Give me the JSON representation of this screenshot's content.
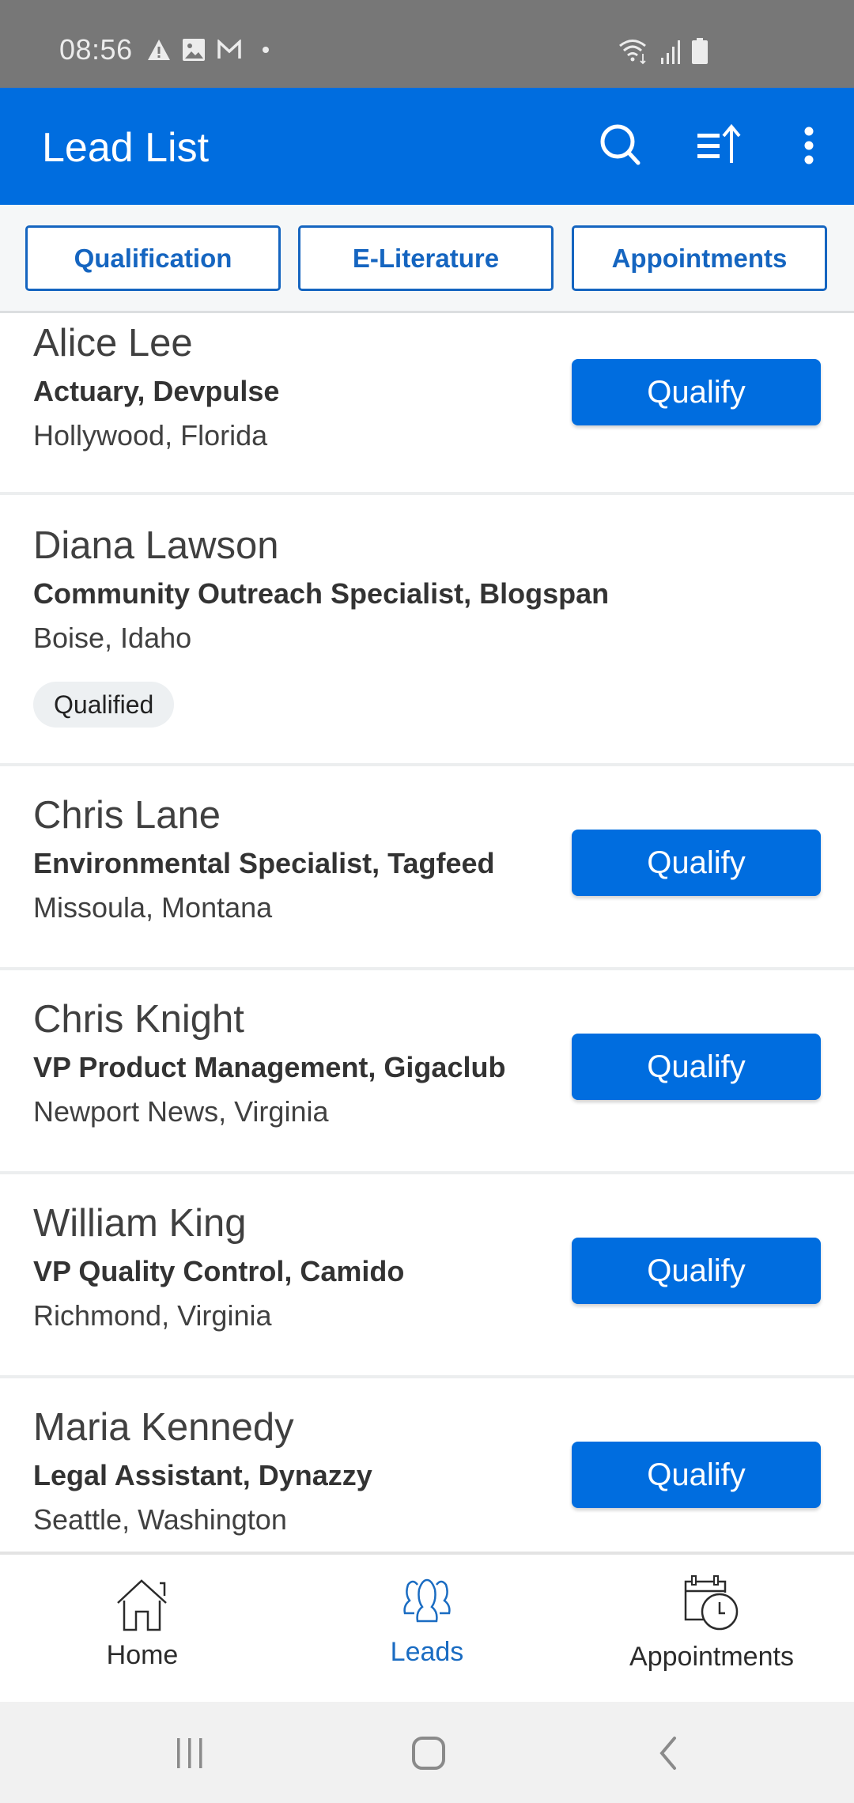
{
  "status_bar": {
    "time": "08:56",
    "left_icons": [
      "warning-icon",
      "image-icon",
      "gmail-icon",
      "dot-icon"
    ],
    "right_icons": [
      "wifi-icon",
      "signal-icon",
      "battery-icon"
    ]
  },
  "app_bar": {
    "title": "Lead List",
    "actions": [
      "search-icon",
      "sort-icon",
      "more-vert-icon"
    ]
  },
  "filters": [
    {
      "label": "Qualification"
    },
    {
      "label": "E-Literature"
    },
    {
      "label": "Appointments"
    }
  ],
  "leads": [
    {
      "name": "Alice Lee",
      "title": "Actuary, Devpulse",
      "location": "Hollywood, Florida",
      "action": "Qualify",
      "status": null
    },
    {
      "name": "Diana Lawson",
      "title": "Community Outreach Specialist, Blogspan",
      "location": "Boise, Idaho",
      "action": null,
      "status": "Qualified"
    },
    {
      "name": "Chris Lane",
      "title": "Environmental Specialist, Tagfeed",
      "location": "Missoula, Montana",
      "action": "Qualify",
      "status": null
    },
    {
      "name": "Chris Knight",
      "title": "VP Product Management, Gigaclub",
      "location": "Newport News, Virginia",
      "action": "Qualify",
      "status": null
    },
    {
      "name": "William King",
      "title": "VP Quality Control, Camido",
      "location": "Richmond, Virginia",
      "action": "Qualify",
      "status": null
    },
    {
      "name": "Maria Kennedy",
      "title": "Legal Assistant, Dynazzy",
      "location": "Seattle, Washington",
      "action": "Qualify",
      "status": null
    }
  ],
  "bottom_nav": [
    {
      "label": "Home",
      "icon": "home-icon",
      "active": false
    },
    {
      "label": "Leads",
      "icon": "people-icon",
      "active": true
    },
    {
      "label": "Appointments",
      "icon": "calendar-clock-icon",
      "active": false
    }
  ],
  "system_nav": [
    "recent-apps-icon",
    "home-button-icon",
    "back-icon"
  ],
  "colors": {
    "primary": "#006ddf",
    "filter_border": "#1565c0",
    "status_bar": "#777777",
    "active_nav": "#1a6cc2"
  }
}
